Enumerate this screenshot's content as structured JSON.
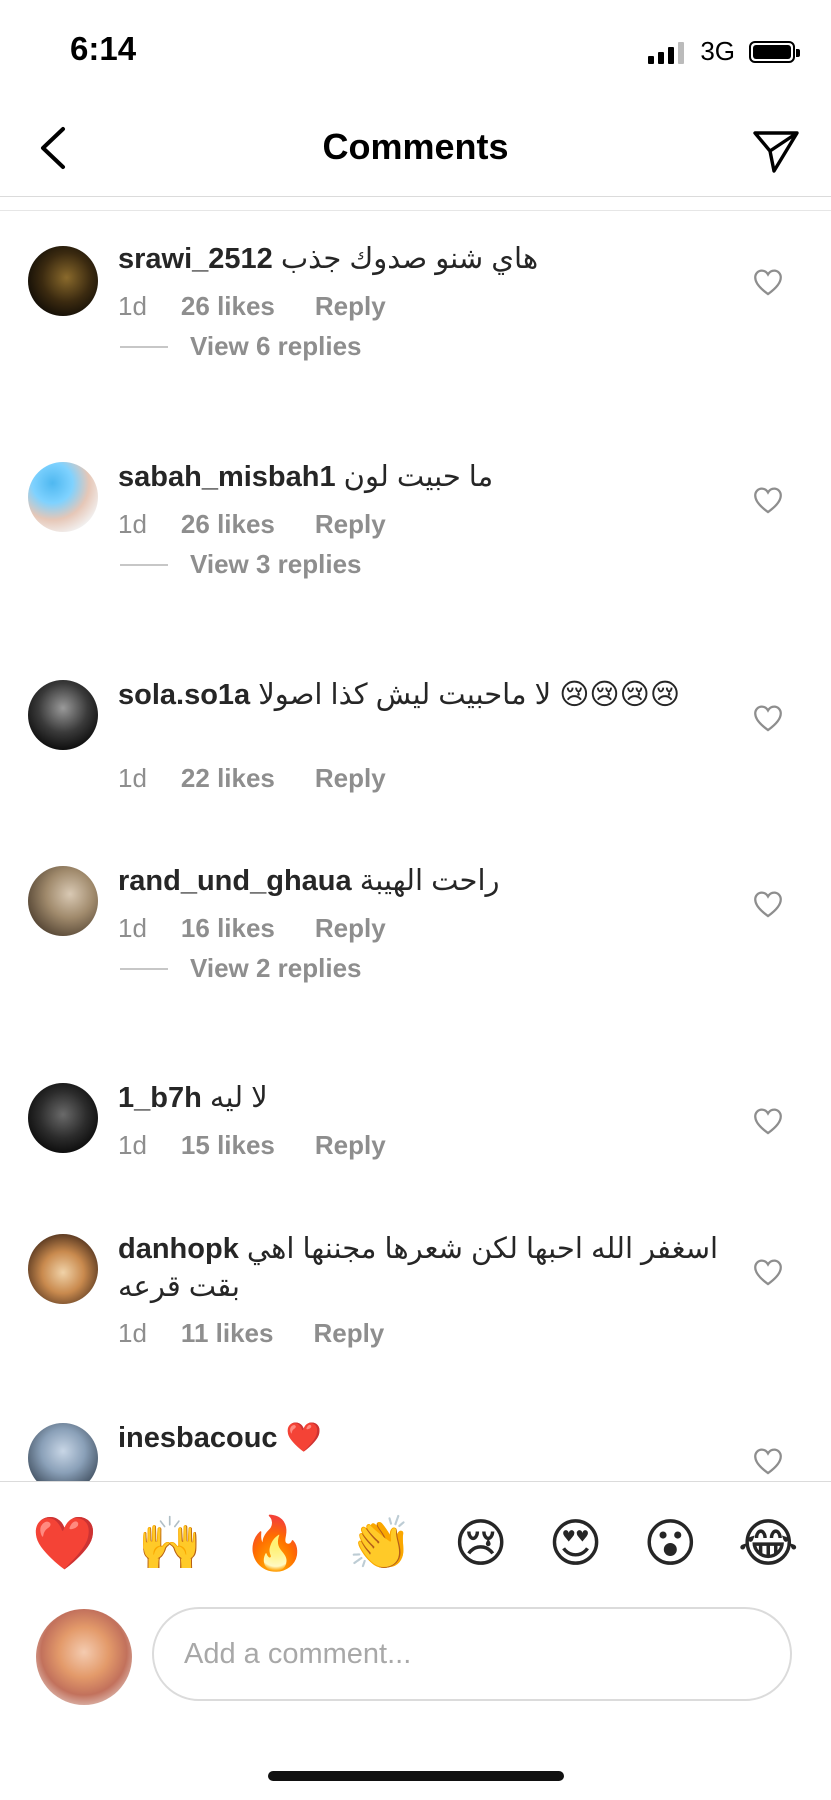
{
  "status_bar": {
    "time": "6:14",
    "network": "3G"
  },
  "header": {
    "title": "Comments",
    "back_icon": "chevron-left-icon",
    "send_icon": "paper-plane-icon"
  },
  "comments": [
    {
      "username": "srawi_2512",
      "text": "هاي شنو صدوك جذب",
      "age": "1d",
      "likes": "26 likes",
      "reply": "Reply",
      "view_replies": "View 6 replies"
    },
    {
      "username": "sabah_misbah1",
      "text": "ما حبيت لون",
      "age": "1d",
      "likes": "26 likes",
      "reply": "Reply",
      "view_replies": "View 3 replies"
    },
    {
      "username": "sola.so1a",
      "text": "لا ماحبيت ليش كذا اصولا 😢😢😢😢",
      "age": "1d",
      "likes": "22 likes",
      "reply": "Reply"
    },
    {
      "username": "rand_und_ghaua",
      "text": "راحت الهيبة",
      "age": "1d",
      "likes": "16 likes",
      "reply": "Reply",
      "view_replies": "View 2 replies"
    },
    {
      "username": "1_b7h",
      "text": "لا ليه",
      "age": "1d",
      "likes": "15 likes",
      "reply": "Reply"
    },
    {
      "username": "danhopk",
      "text": "اسغفر الله احبها لكن شعرها مجننها اهي بقت قرعه",
      "age": "1d",
      "likes": "11 likes",
      "reply": "Reply"
    },
    {
      "username": "inesbacouc",
      "text": "❤️"
    }
  ],
  "reactions": [
    "❤️",
    "🙌",
    "🔥",
    "👏",
    "😢",
    "😍",
    "😮",
    "😂"
  ],
  "composer": {
    "placeholder": "Add a comment..."
  }
}
